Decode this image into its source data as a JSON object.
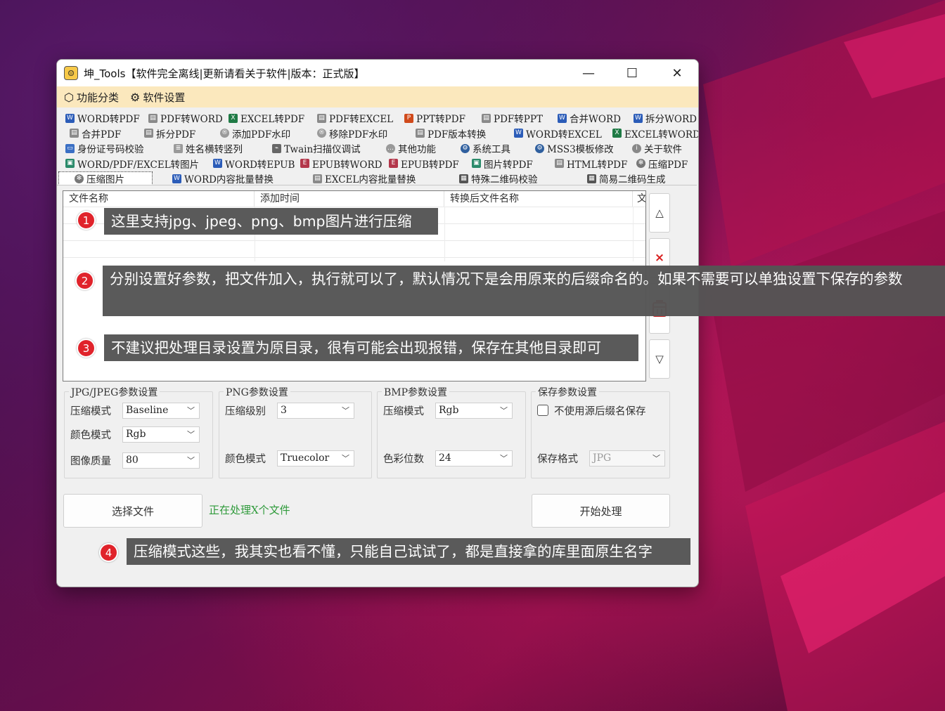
{
  "window": {
    "title": "坤_Tools【软件完全离线|更新请看关于软件|版本：正式版】",
    "minimize": "—",
    "maximize": "☐",
    "close": "✕"
  },
  "menu": {
    "items": [
      {
        "label": "功能分类",
        "icon": "cube-icon"
      },
      {
        "label": "软件设置",
        "icon": "gear-icon"
      }
    ]
  },
  "tabs": [
    [
      "WORD转PDF",
      "PDF转WORD",
      "EXCEL转PDF",
      "PDF转EXCEL",
      "PPT转PDF",
      "PDF转PPT",
      "合并WORD",
      "拆分WORD"
    ],
    [
      "合并PDF",
      "拆分PDF",
      "添加PDF水印",
      "移除PDF水印",
      "PDF版本转换",
      "WORD转EXCEL",
      "EXCEL转WORD"
    ],
    [
      "身份证号码校验",
      "姓名横转竖列",
      "Twain扫描仪调试",
      "其他功能",
      "系统工具",
      "MSS3模板修改",
      "关于软件"
    ],
    [
      "WORD/PDF/EXCEL转图片",
      "WORD转EPUB",
      "EPUB转WORD",
      "EPUB转PDF",
      "图片转PDF",
      "HTML转PDF",
      "压缩PDF"
    ],
    [
      "压缩图片",
      "WORD内容批量替换",
      "EXCEL内容批量替换",
      "特殊二维码校验",
      "简易二维码生成"
    ]
  ],
  "selected_tab": "压缩图片",
  "file_list": {
    "columns": [
      "文件名称",
      "添加时间",
      "转换后文件名称",
      "文"
    ]
  },
  "side_buttons": [
    "△",
    "×",
    "▽"
  ],
  "jpeg_group": {
    "title": "JPG/JPEG参数设置",
    "compress_mode_label": "压缩模式",
    "compress_mode_value": "Baseline",
    "color_mode_label": "颜色模式",
    "color_mode_value": "Rgb",
    "quality_label": "图像质量",
    "quality_value": "80"
  },
  "png_group": {
    "title": "PNG参数设置",
    "level_label": "压缩级别",
    "level_value": "3",
    "color_mode_label": "颜色模式",
    "color_mode_value": "Truecolor"
  },
  "bmp_group": {
    "title": "BMP参数设置",
    "compress_mode_label": "压缩模式",
    "compress_mode_value": "Rgb",
    "depth_label": "色彩位数",
    "depth_value": "24"
  },
  "save_group": {
    "title": "保存参数设置",
    "no_suffix_label": "不使用源后缀名保存",
    "format_label": "保存格式",
    "format_value": "JPG"
  },
  "actions": {
    "select_files": "选择文件",
    "status": "正在处理X个文件",
    "start": "开始处理"
  },
  "callouts": [
    {
      "num": "1",
      "text": "这里支持jpg、jpeg、png、bmp图片进行压缩"
    },
    {
      "num": "2",
      "text": "分别设置好参数，把文件加入，执行就可以了，默认情况下是会用原来的后缀命名的。如果不需要可以单独设置下保存的参数"
    },
    {
      "num": "3",
      "text": "不建议把处理目录设置为原目录，很有可能会出现报错，保存在其他目录即可"
    },
    {
      "num": "4",
      "text": "压缩模式这些，我其实也看不懂，只能自己试试了，都是直接拿的库里面原生名字"
    }
  ],
  "colors": {
    "menu_bg": "#fbe8bd",
    "status_green": "#2e9a3a",
    "badge_red": "#e0232b"
  }
}
